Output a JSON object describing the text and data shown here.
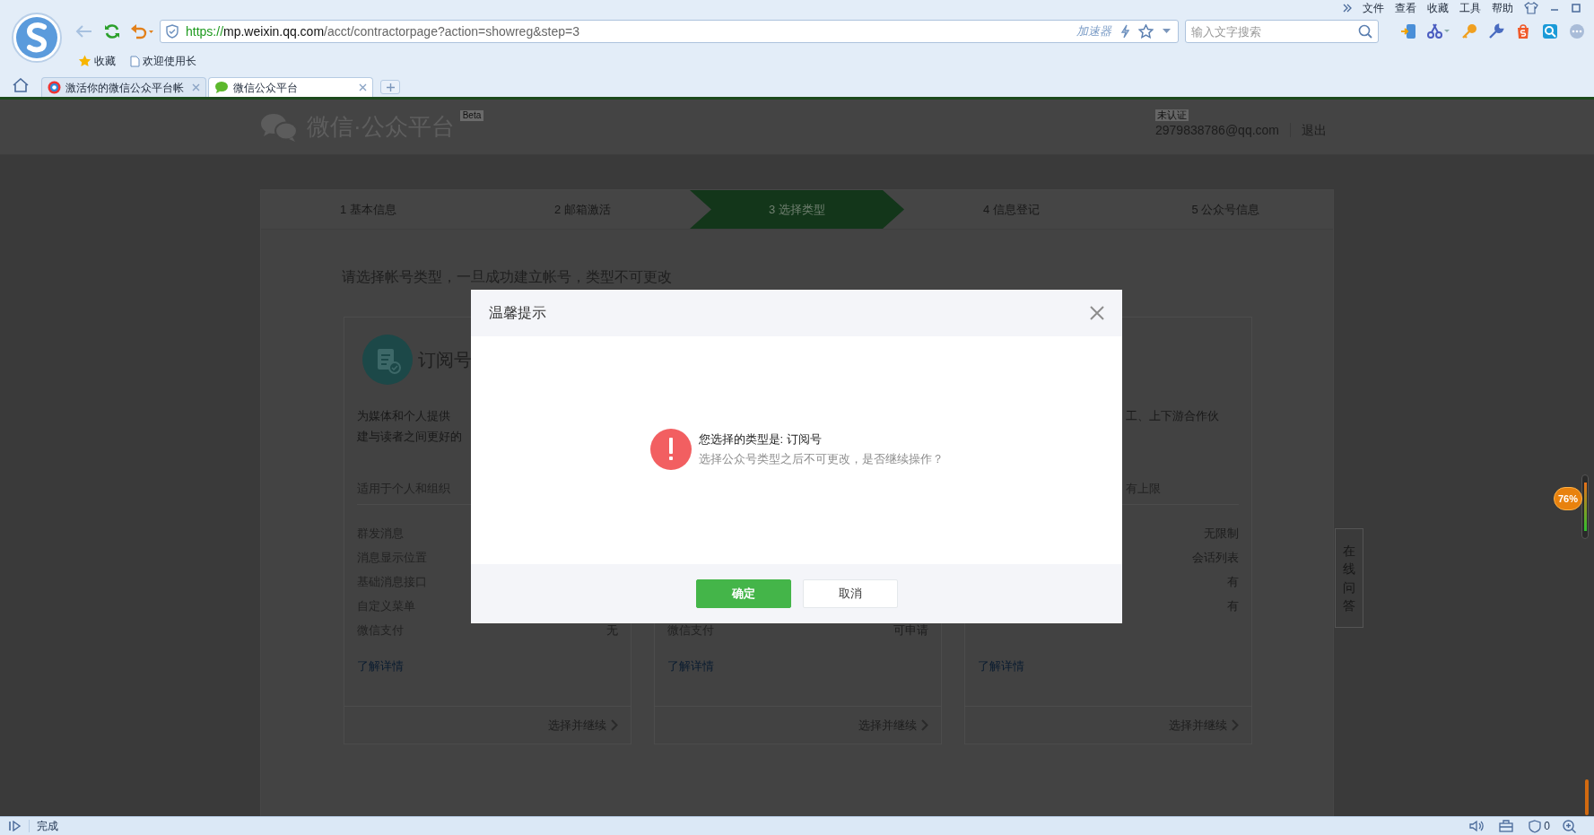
{
  "browser": {
    "menu": [
      "文件",
      "查看",
      "收藏",
      "工具",
      "帮助"
    ],
    "address": {
      "scheme": "https://",
      "host": "mp.weixin.qq.com",
      "path": "/acct/contractorpage?action=showreg&step=3"
    },
    "accelerator": "加速器",
    "search": {
      "placeholder": "输入文字搜索"
    },
    "bookmarks": [
      "收藏",
      "欢迎使用长"
    ],
    "tabs": [
      {
        "label": "激活你的微信公众平台帐",
        "selected": false
      },
      {
        "label": "微信公众平台",
        "selected": true
      }
    ]
  },
  "page": {
    "logo_text": "微信·公众平台",
    "logo_badge": "Beta",
    "account": {
      "status": "未认证",
      "email": "2979838786@qq.com",
      "logout": "退出"
    },
    "steps": [
      {
        "label": "1 基本信息",
        "selected": false
      },
      {
        "label": "2 邮箱激活",
        "selected": false
      },
      {
        "label": "3 选择类型",
        "selected": true
      },
      {
        "label": "4 信息登记",
        "selected": false
      },
      {
        "label": "5 公众号信息",
        "selected": false
      }
    ],
    "heading": "请选择帐号类型，一旦成功建立帐号，类型不可更改",
    "cards": [
      {
        "kind": "full",
        "title": "订阅号",
        "description": [
          "为媒体和个人提供",
          "建与读者之间更好的"
        ],
        "audience": "适用于个人和组织",
        "features": [
          {
            "label": "群发消息"
          },
          {
            "label": "消息显示位置"
          },
          {
            "label": "基础消息接口"
          },
          {
            "label": "自定义菜单"
          },
          {
            "label": "微信支付",
            "value": "无"
          }
        ],
        "link": "了解详情",
        "action": "选择并继续"
      },
      {
        "kind": "bottom",
        "features": [
          {
            "label": "微信支付",
            "value": "可申请"
          }
        ],
        "link": "了解详情",
        "action": "选择并继续"
      },
      {
        "kind": "right",
        "description": [
          "工、上下游合作伙"
        ],
        "audience": "有上限",
        "features": [
          {
            "value": "无限制"
          },
          {
            "value": "会话列表"
          },
          {
            "value": "有"
          },
          {
            "value": "有"
          }
        ],
        "link": "了解详情",
        "action": "选择并继续"
      }
    ],
    "side_tab": "在线问答",
    "memory_badge": "76%"
  },
  "dialog": {
    "title": "温馨提示",
    "message": "您选择的类型是: 订阅号",
    "note": "选择公众号类型之后不可更改，是否继续操作？",
    "buttons": [
      {
        "label": "确定",
        "kind": "primary"
      },
      {
        "label": "取消",
        "kind": "default"
      }
    ]
  },
  "status_bar": {
    "text": "完成",
    "blocked_count": "0"
  }
}
